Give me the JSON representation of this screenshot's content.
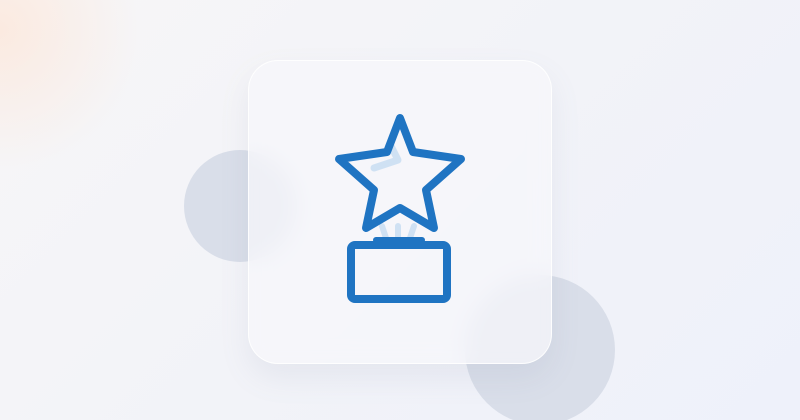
{
  "illustration": {
    "icon": "star-trophy-icon",
    "colors": {
      "background_start": "#f7f6f7",
      "background_end": "#eef1fa",
      "warm_glow": "#ffe0cd",
      "blob": "#d9dee9",
      "card": "#f6f7fb",
      "icon_stroke": "#1f74c2",
      "icon_accent": "#cfe1f3"
    }
  }
}
